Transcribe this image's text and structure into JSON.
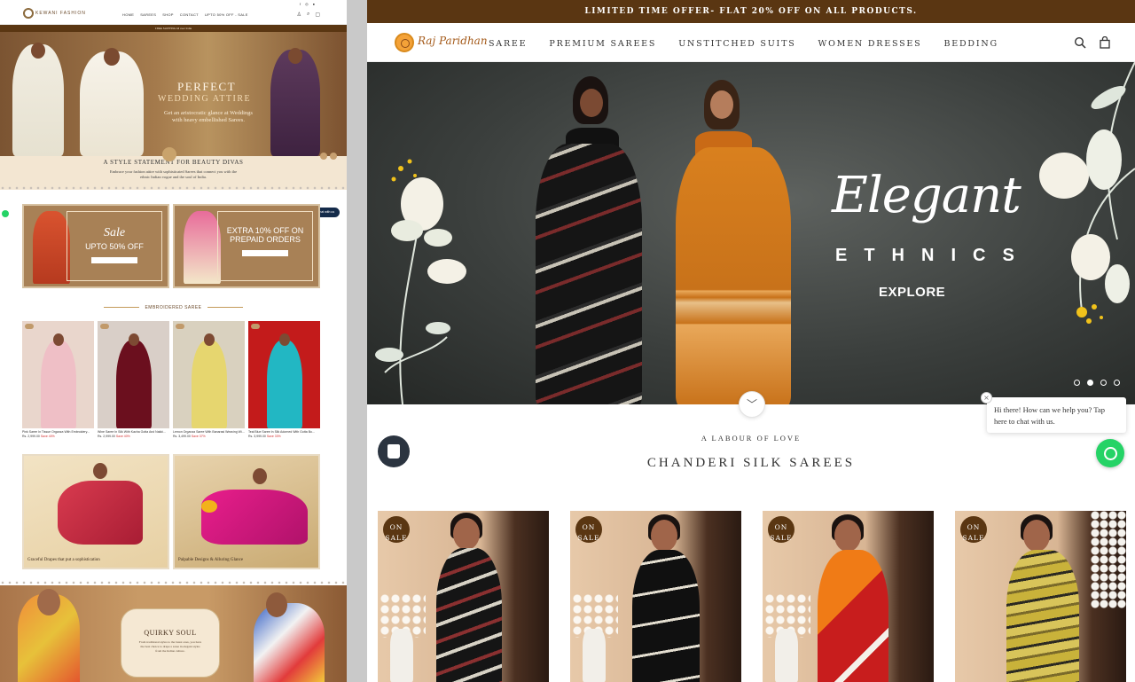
{
  "left_preview": {
    "brand": "KEWANI FASHION",
    "nav": [
      "HOME",
      "SAREES",
      "SHOP",
      "CONTACT",
      "UPTO 50% OFF - SALE"
    ],
    "shipping_bar": "FREE SHIPPING All over India",
    "hero_title": "PERFECT",
    "hero_subtitle": "WEDDING ATTIRE",
    "hero_text": "Get an aristocratic glance at Weddings with heavy embellished Sarees.",
    "statement_title": "A STYLE STATEMENT FOR BEAUTY DIVAS",
    "statement_text": "Embrace your fashion attire with sophisticated Sarees that connect you with the ethnic Indian vogue and the soul of India.",
    "chat_label": "Chat with us",
    "promo_1": {
      "script": "Sale",
      "text": "UPTO 50% OFF"
    },
    "promo_2": {
      "script": "",
      "text": "EXTRA 10% OFF ON PREPAID ORDERS"
    },
    "section_title": "EMBROIDERED SAREE",
    "products": [
      {
        "name": "Pink Saree In Tissue Organza With Embroidery...",
        "price": "Rs. 2,999.00",
        "sale": "Save 40%"
      },
      {
        "name": "Wine Saree In Silk With Kacha Gotta And Nakki...",
        "price": "Rs. 2,999.00",
        "sale": "Save 40%"
      },
      {
        "name": "Lemon Organza Saree With Banarasi Weaving Wi...",
        "price": "Rs. 3,499.00",
        "sale": "Save 37%"
      },
      {
        "name": "Teal Blue Saree In Silk Adorned With Gotta Bo...",
        "price": "Rs. 3,999.00",
        "sale": "Save 33%"
      }
    ],
    "lifestyle_1": "Graceful Drapes that put a sophistication",
    "lifestyle_2": "Palpable Designs & Alluring Glance",
    "quirky_title": "QUIRKY SOUL",
    "quirky_text": "From traditional styles to the latest ones, you have the best choice to drape a saree in elegant styles from the Indian culture."
  },
  "announcement": "LIMITED TIME OFFER- FLAT 20% OFF ON ALL PRODUCTS.",
  "logo_text": "Raj Paridhan",
  "nav": [
    "SAREE",
    "PREMIUM SAREES",
    "UNSTITCHED SUITS",
    "WOMEN DRESSES",
    "BEDDING"
  ],
  "icons": {
    "search": "search-icon",
    "cart": "shopping-bag-icon",
    "scroll": "chevron-down-icon",
    "shop": "shopify-bag-icon",
    "whatsapp": "whatsapp-icon"
  },
  "hero": {
    "title": "Elegant",
    "subtitle": "ETHNICS",
    "cta": "EXPLORE",
    "active_slide": 2,
    "slide_count": 4
  },
  "section": {
    "kicker": "A LABOUR OF LOVE",
    "title": "CHANDERI SILK SAREES"
  },
  "product_badges": [
    "ON SALE",
    "ON SALE",
    "ON SALE",
    "ON SALE"
  ],
  "chat_tooltip": "Hi there! How can we help you? Tap here to chat with us.",
  "colors": {
    "brand_brown": "#5a3612",
    "whatsapp": "#25d366",
    "logo_orange": "#f4a238"
  }
}
